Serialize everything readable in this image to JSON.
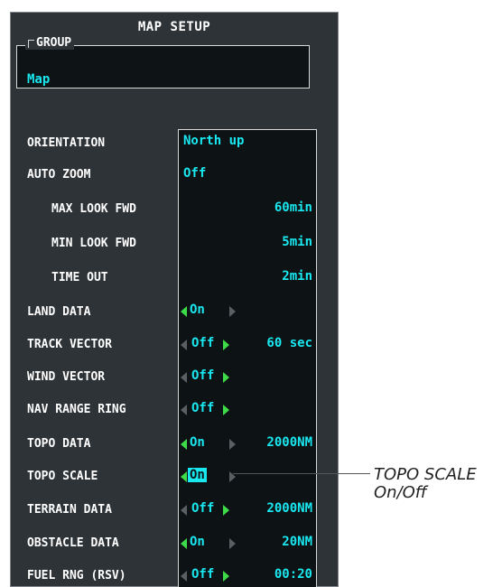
{
  "panel": {
    "title": "MAP SETUP"
  },
  "group": {
    "legend": "GROUP",
    "value": "Map"
  },
  "rows": [
    {
      "label": "ORIENTATION",
      "value": "North up"
    },
    {
      "label": "AUTO ZOOM",
      "value": "Off"
    },
    {
      "label": "MAX LOOK FWD",
      "value": "60min"
    },
    {
      "label": "MIN LOOK FWD",
      "value": "5min"
    },
    {
      "label": "TIME OUT",
      "value": "2min"
    },
    {
      "label": "LAND DATA",
      "value": "On"
    },
    {
      "label": "TRACK VECTOR",
      "value": "Off",
      "extra": "60 sec"
    },
    {
      "label": "WIND VECTOR",
      "value": "Off"
    },
    {
      "label": "NAV RANGE RING",
      "value": "Off"
    },
    {
      "label": "TOPO DATA",
      "value": "On",
      "extra": "2000NM"
    },
    {
      "label": "TOPO SCALE",
      "value": "On"
    },
    {
      "label": "TERRAIN DATA",
      "value": "Off",
      "extra": "2000NM"
    },
    {
      "label": "OBSTACLE DATA",
      "value": "On",
      "extra": "20NM"
    },
    {
      "label": "FUEL RNG (RSV)",
      "value": "Off",
      "extra": "00:20"
    }
  ],
  "callout": {
    "line1": "TOPO SCALE",
    "line2": "On/Off"
  },
  "colors": {
    "accent": "#19e8f0",
    "arrow_active": "#3fdc4a",
    "panel_bg": "#2e3337"
  }
}
